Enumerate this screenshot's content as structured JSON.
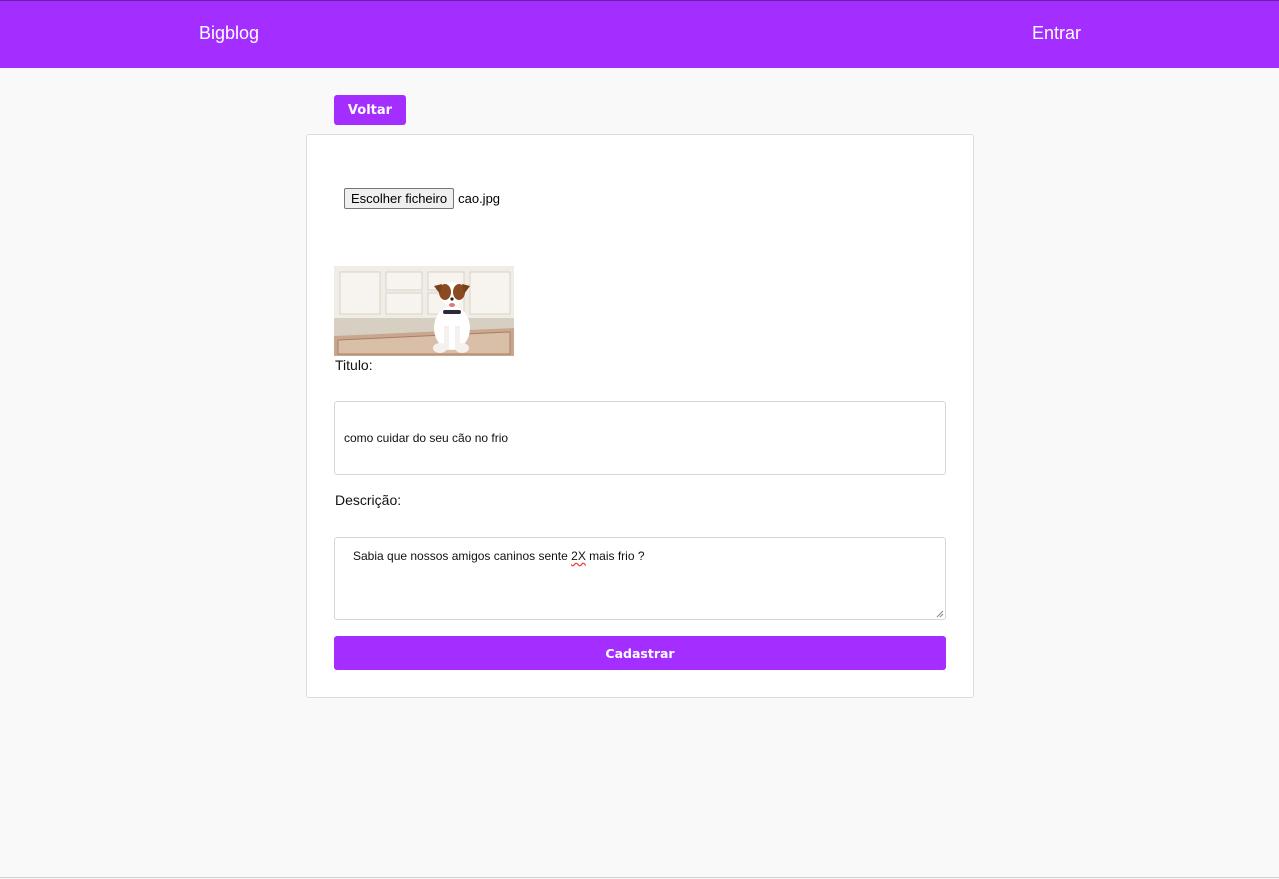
{
  "navbar": {
    "brand": "Bigblog",
    "login_label": "Entrar",
    "color": "#a32eff"
  },
  "back_button": {
    "label": "Voltar"
  },
  "form": {
    "file_button_label": "Escolher ficheiro",
    "file_name": "cao.jpg",
    "preview_image": "dog-photo",
    "title_label": "Titulo:",
    "title_value": "como cuidar do seu cão no frio",
    "description_label": "Descrição:",
    "description_prefix": "Sabia que nossos amigos caninos sente ",
    "description_flagged": "2X",
    "description_suffix": " mais frio ?",
    "submit_label": "Cadastrar"
  }
}
